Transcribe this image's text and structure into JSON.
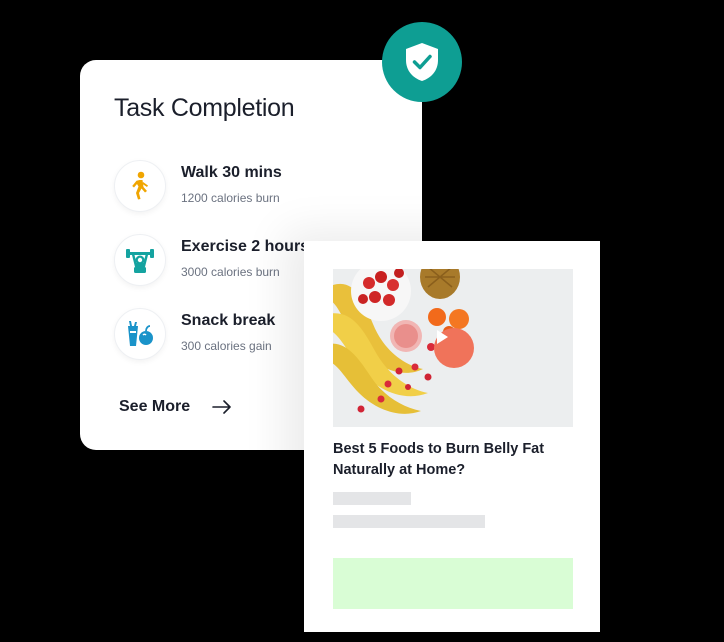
{
  "task_card": {
    "title": "Task Completion",
    "items": [
      {
        "name": "Walk 30 mins",
        "detail": "1200 calories burn",
        "icon": "walking-person-icon"
      },
      {
        "name": "Exercise 2 hours",
        "detail": "3000 calories burn",
        "icon": "dumbbell-exercise-icon"
      },
      {
        "name": "Snack break",
        "detail": "300 calories gain",
        "icon": "snack-icon"
      }
    ],
    "see_more_label": "See More"
  },
  "video_card": {
    "title": "Best 5 Foods to Burn Belly Fat Naturally at Home?"
  },
  "colors": {
    "teal": "#0e9e93",
    "walk_icon": "#f0a500",
    "exercise_icon": "#14a3a0",
    "snack_icon": "#1a93c9",
    "play_button": "#f0735a",
    "cta_green": "#d9fdd5"
  }
}
